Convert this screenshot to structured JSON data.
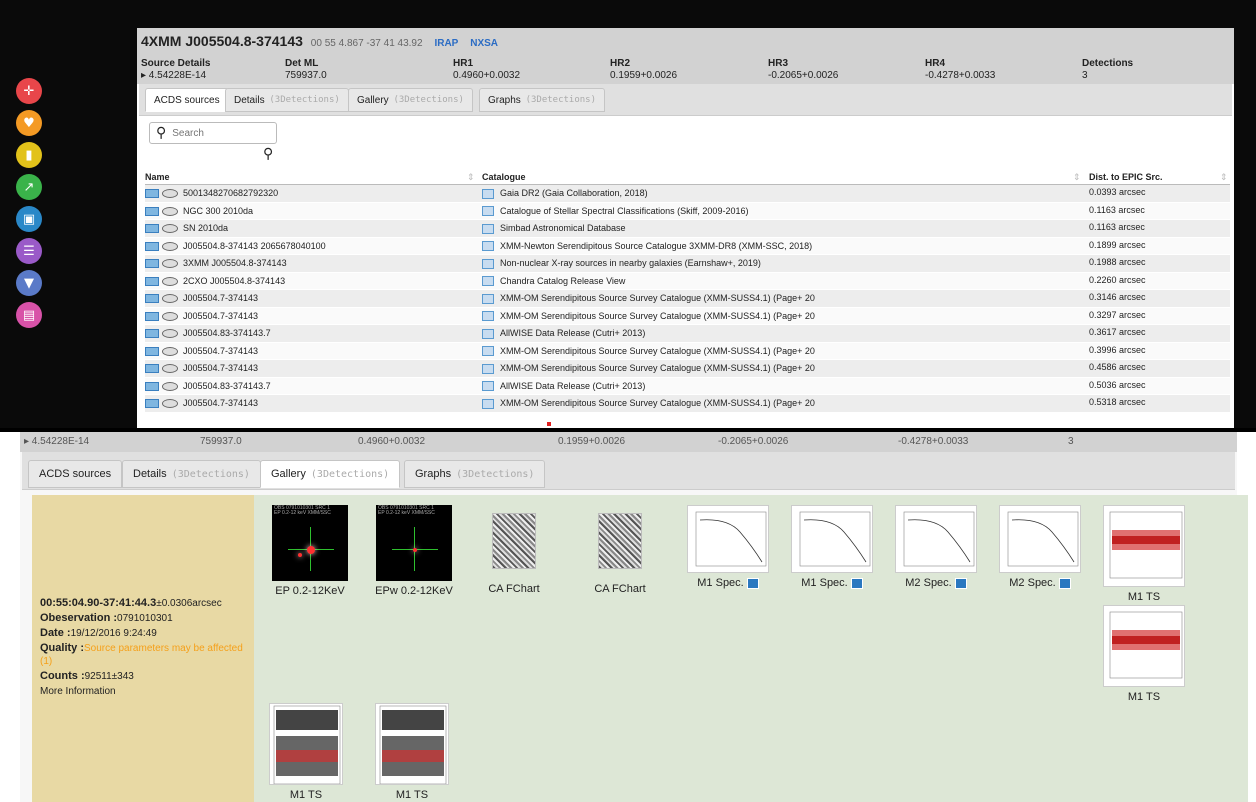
{
  "source": {
    "name": "4XMM J005504.8-374143",
    "coords": "00 55 4.867 -37 41 43.92",
    "link_irap": "IRAP",
    "link_nxsa": "NXSA",
    "details_label": "Source Details",
    "flux": "▸ 4.54228E-14",
    "det_ml_label": "Det ML",
    "det_ml": "759937.0",
    "hr1_label": "HR1",
    "hr1": "0.4960+0.0032",
    "hr2_label": "HR2",
    "hr2": "0.1959+0.0026",
    "hr3_label": "HR3",
    "hr3": "-0.2065+0.0026",
    "hr4_label": "HR4",
    "hr4": "-0.4278+0.0033",
    "detections_label": "Detections",
    "detections": "3"
  },
  "tabs": {
    "acds": "ACDS sources",
    "details": "Details",
    "gallery": "Gallery",
    "graphs": "Graphs",
    "sub": "(3Detections)"
  },
  "search": {
    "placeholder": "Search"
  },
  "grid": {
    "col_name": "Name",
    "col_catalogue": "Catalogue",
    "col_dist": "Dist. to EPIC Src.",
    "rows": [
      {
        "name": "5001348270682792320",
        "catalogue": "Gaia DR2 (Gaia Collaboration, 2018)",
        "dist": "0.0393 arcsec"
      },
      {
        "name": "NGC 300 2010da",
        "catalogue": "Catalogue of Stellar Spectral Classifications (Skiff, 2009-2016)",
        "dist": "0.1163 arcsec"
      },
      {
        "name": "SN 2010da",
        "catalogue": "Simbad Astronomical Database",
        "dist": "0.1163 arcsec"
      },
      {
        "name": "J005504.8-374143 2065678040100",
        "catalogue": "XMM-Newton Serendipitous Source Catalogue 3XMM-DR8 (XMM-SSC, 2018)",
        "dist": "0.1899 arcsec"
      },
      {
        "name": "3XMM J005504.8-374143",
        "catalogue": "Non-nuclear X-ray sources in nearby galaxies (Earnshaw+, 2019)",
        "dist": "0.1988 arcsec"
      },
      {
        "name": "2CXO J005504.8-374143",
        "catalogue": "Chandra Catalog Release View",
        "dist": "0.2260 arcsec"
      },
      {
        "name": "J005504.7-374143",
        "catalogue": "XMM-OM Serendipitous Source Survey Catalogue (XMM-SUSS4.1) (Page+ 20",
        "dist": "0.3146 arcsec"
      },
      {
        "name": "J005504.7-374143",
        "catalogue": "XMM-OM Serendipitous Source Survey Catalogue (XMM-SUSS4.1) (Page+ 20",
        "dist": "0.3297 arcsec"
      },
      {
        "name": "J005504.83-374143.7",
        "catalogue": "AllWISE Data Release (Cutri+ 2013)",
        "dist": "0.3617 arcsec"
      },
      {
        "name": "J005504.7-374143",
        "catalogue": "XMM-OM Serendipitous Source Survey Catalogue (XMM-SUSS4.1) (Page+ 20",
        "dist": "0.3996 arcsec"
      },
      {
        "name": "J005504.7-374143",
        "catalogue": "XMM-OM Serendipitous Source Survey Catalogue (XMM-SUSS4.1) (Page+ 20",
        "dist": "0.4586 arcsec"
      },
      {
        "name": "J005504.83-374143.7",
        "catalogue": "AllWISE Data Release (Cutri+ 2013)",
        "dist": "0.5036 arcsec"
      },
      {
        "name": "J005504.7-374143",
        "catalogue": "XMM-OM Serendipitous Source Survey Catalogue (XMM-SUSS4.1) (Page+ 20",
        "dist": "0.5318 arcsec"
      }
    ]
  },
  "cutoff_row": {
    "flux": "▸ 4.54228E-14",
    "det_ml": "759937.0",
    "hr1": "0.4960+0.0032",
    "hr2": "0.1959+0.0026",
    "hr3": "-0.2065+0.0026",
    "hr4": "-0.4278+0.0033",
    "detections": "3"
  },
  "info": {
    "position": "00:55:04.90-37:41:44.3",
    "position_err": "±0.0306arcsec",
    "observation_label": "Obeservation :",
    "observation": "0791010301",
    "date_label": "Date :",
    "date": "19/12/2016 9:24:49",
    "quality_label": "Quality :",
    "quality": "Source parameters may be affected (1)",
    "counts_label": "Counts :",
    "counts": "92511±343",
    "more": "More Information"
  },
  "gallery": {
    "ep": "EP 0.2-12KeV",
    "epw": "EPw 0.2-12KeV",
    "ca1": "CA FChart",
    "ca2": "CA FChart",
    "m1spec1": "M1 Spec.",
    "m1spec2": "M1 Spec.",
    "m2spec1": "M2 Spec.",
    "m2spec2": "M2 Spec.",
    "m1ts1": "M1 TS",
    "m1ts2": "M1 TS",
    "m1ts3": "M1 TS",
    "m1ts4": "M1 TS",
    "obs_hdr": "OBS 0791010301 SRC 1",
    "ep_hdr": "EP 0.2-12 keV XMM/SSC"
  },
  "colors": {
    "side_red": "#e8464a",
    "side_orange": "#f49a24",
    "side_yellow": "#e2c21a",
    "side_green": "#3ab34a",
    "side_blue": "#2a88c8",
    "side_purple": "#9a5ac8",
    "side_indigo": "#5a7ac8",
    "side_pink": "#d852a8",
    "link": "#2b6cc4",
    "warn": "#f5a01a",
    "info_bg": "#e8d9a4",
    "gallery_bg": "#dde7d6"
  },
  "icons": [
    "crosshair-icon",
    "heart-icon",
    "book-icon",
    "external-icon",
    "image-icon",
    "list-icon",
    "filter-icon",
    "document-icon"
  ]
}
